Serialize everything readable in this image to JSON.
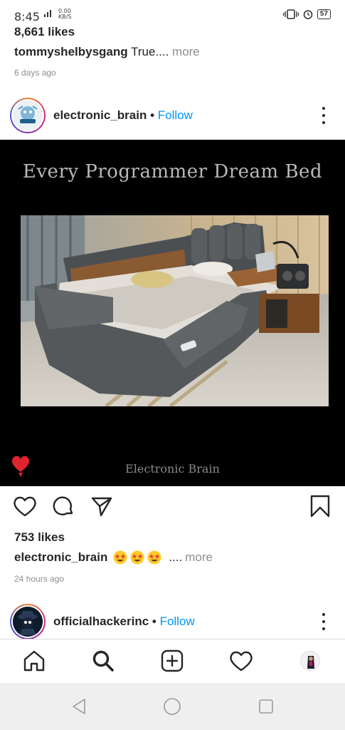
{
  "status_bar": {
    "time": "8:45",
    "net_line1": "0.00",
    "net_line2": "KB/S",
    "battery": "57",
    "network_icon": "signal-icon"
  },
  "previous_post": {
    "likes": "8,661 likes",
    "username": "tommyshelbysgang",
    "caption_text": "True....",
    "more_label": "more",
    "time": "6 days ago"
  },
  "post": {
    "username": "electronic_brain",
    "separator": "•",
    "follow_label": "Follow",
    "image_title": "Every Programmer Dream Bed",
    "image_footer": "Electronic Brain",
    "likes": "753 likes",
    "caption_username": "electronic_brain",
    "caption_suffix": "....",
    "more_label": "more",
    "time": "24 hours ago"
  },
  "next_post": {
    "username": "officialhackerinc",
    "separator": "•",
    "follow_label": "Follow"
  },
  "bottom_nav": [
    "home-icon",
    "search-icon",
    "add-post-icon",
    "activity-heart-icon",
    "profile-avatar"
  ],
  "colors": {
    "follow": "#0095f6",
    "text": "#262626",
    "muted": "#8e8e8e",
    "like_heart": "#e0242f"
  }
}
